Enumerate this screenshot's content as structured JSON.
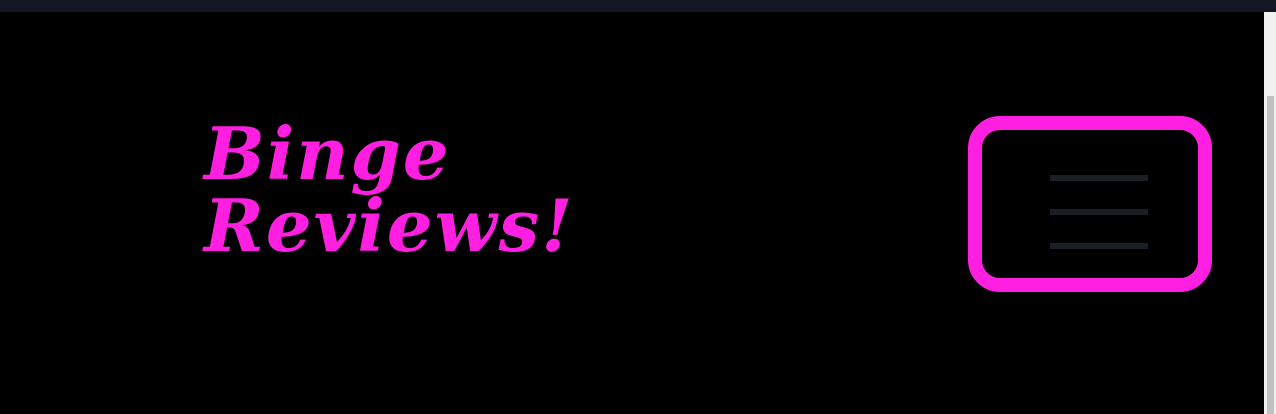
{
  "navbar": {
    "brand": {
      "line1": "Binge",
      "line2": "Reviews!"
    },
    "toggler": {
      "icon": "hamburger-menu-icon"
    }
  },
  "colors": {
    "accent": "#ff1fe0",
    "background": "#000000",
    "toggler_bars": "#1a1f26"
  }
}
